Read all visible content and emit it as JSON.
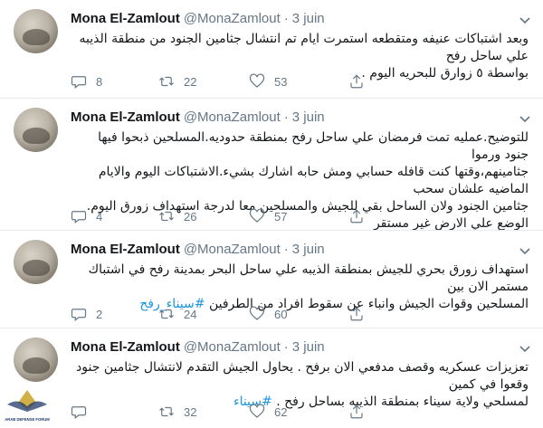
{
  "tweets": [
    {
      "name": "Mona El-Zamlout",
      "handle": "@MonaZamlout",
      "sep": "·",
      "date": "3 juin",
      "lines": [
        "وبعد اشتباكات عنيفه ومتقطعه استمرت ايام تم انتشال جثامين الجنود من منطقة الذيبه علي ساحل رفح",
        "بواسطة ٥ زوارق للبحريه اليوم ."
      ],
      "replies": "8",
      "retweets": "22",
      "likes": "53"
    },
    {
      "name": "Mona El-Zamlout",
      "handle": "@MonaZamlout",
      "sep": "·",
      "date": "3 juin",
      "lines": [
        "للتوضيح.عمليه تمت فرمضان علي ساحل رفح بمنطقة حدوديه.المسلحين ذبحوا فيها جنود ورموا",
        "جثامينهم،وقتها كنت قافله حسابي ومش حابه اشارك بشيء.الاشتباكات اليوم والايام الماضيه علشان سحب",
        "جثامين الجنود ولان الساحل بقي للجيش والمسلحين معا لدرجة استهداف زورق اليوم.",
        "الوضع علي الارض غير مستقر"
      ],
      "replies": "4",
      "retweets": "26",
      "likes": "57"
    },
    {
      "name": "Mona El-Zamlout",
      "handle": "@MonaZamlout",
      "sep": "·",
      "date": "3 juin",
      "lines": [
        "استهداف زورق بحري للجيش بمنطقة الذيبه علي ساحل البحر بمدينة رفح في اشتباك مستمر الان بين",
        "المسلحين وقوات الجيش وانباء عن سقوط افراد من الطرفين"
      ],
      "hashtag": "#سيناء_رفح",
      "replies": "2",
      "retweets": "24",
      "likes": "60"
    },
    {
      "name": "Mona El-Zamlout",
      "handle": "@MonaZamlout",
      "sep": "·",
      "date": "3 juin",
      "lines": [
        "تعزيزات عسكريه وقصف مدفعي الان برفح . يحاول الجيش التقدم لانتشال جثامين جنود وقعوا في كمين",
        "لمسلحي ولاية سيناء بمنطقة الذيبه بساحل رفح ."
      ],
      "hashtag": "#سيناء",
      "replies": "",
      "retweets": "32",
      "likes": "62"
    }
  ],
  "watermark": {
    "text": "ARAB DEFENSE FORUM",
    "accent": "#c9a227"
  },
  "colors": {
    "hashtag": "#1b95e0",
    "muted": "#657786",
    "divider": "#e6ecf0"
  }
}
